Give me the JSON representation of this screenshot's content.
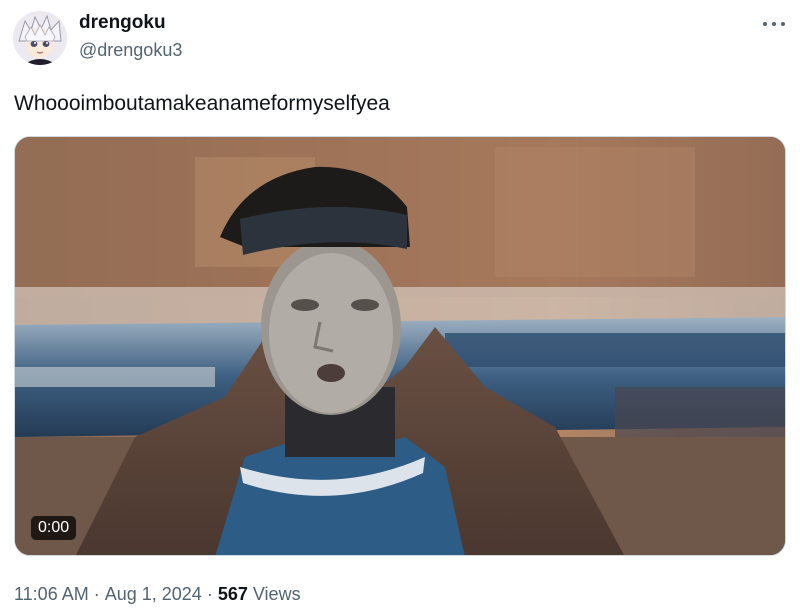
{
  "author": {
    "display_name": "drengoku",
    "handle": "@drengoku3",
    "avatar_icon": "anime-avatar"
  },
  "more_icon": "more-horizontal-icon",
  "tweet": {
    "text": "Whoooimboutamakeanameformyselfyea"
  },
  "media": {
    "type": "video",
    "duration": "0:00"
  },
  "meta": {
    "time": "11:06 AM",
    "date": "Aug 1, 2024",
    "views_count": "567",
    "views_label": "Views",
    "separator": "·"
  },
  "colors": {
    "text": "#0f1419",
    "secondary": "#536471",
    "border": "#cfd9de"
  }
}
